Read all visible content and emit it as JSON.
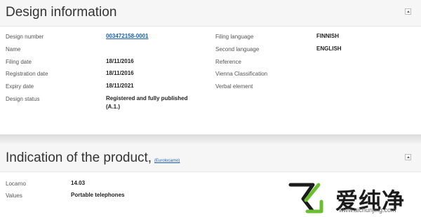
{
  "design_info": {
    "title": "Design information",
    "left_fields": [
      {
        "label": "Design number",
        "value": "003472158-0001"
      },
      {
        "label": "Name",
        "value": ""
      },
      {
        "label": "Filing date",
        "value": "18/11/2016"
      },
      {
        "label": "Registration date",
        "value": "18/11/2016"
      },
      {
        "label": "Expiry date",
        "value": "18/11/2021"
      },
      {
        "label": "Design status",
        "value_line1": "Registered and fully published",
        "value_line2": "(A.1.)"
      }
    ],
    "right_fields": [
      {
        "label": "Filing language",
        "value": "FINNISH"
      },
      {
        "label": "Second language",
        "value": "ENGLISH"
      },
      {
        "label": "Reference",
        "value": ""
      },
      {
        "label": "Vienna Classification",
        "value": ""
      },
      {
        "label": "Verbal element",
        "value": ""
      }
    ]
  },
  "product": {
    "title": "Indication of the product,",
    "link": "(Eurolocarno)",
    "fields": [
      {
        "label": "Locarno",
        "value": "14.03"
      },
      {
        "label": "Values",
        "value": "Portable telephones"
      }
    ]
  },
  "watermark": {
    "text": "爱纯净",
    "url": "www.aichunjing.com",
    "logo_color": "#6abf2e"
  }
}
